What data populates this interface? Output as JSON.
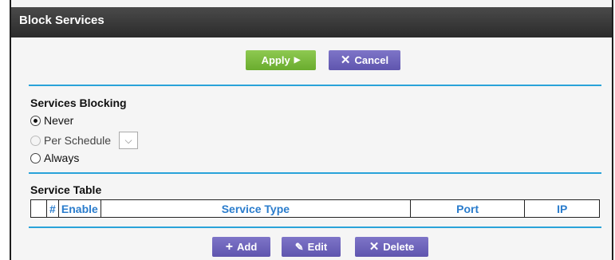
{
  "page": {
    "title": "Block Services"
  },
  "actions": {
    "apply_label": "Apply",
    "apply_icon": "play-icon",
    "cancel_label": "Cancel",
    "cancel_icon": "close-icon"
  },
  "blocking": {
    "title": "Services Blocking",
    "options": [
      {
        "label": "Never",
        "selected": true,
        "enabled": true
      },
      {
        "label": "Per Schedule",
        "selected": false,
        "enabled": false
      },
      {
        "label": "Always",
        "selected": false,
        "enabled": true
      }
    ],
    "schedule_select_value": ""
  },
  "service_table": {
    "title": "Service Table",
    "columns": [
      "",
      "#",
      "Enable",
      "Service Type",
      "Port",
      "IP"
    ],
    "rows": []
  },
  "table_actions": {
    "add_label": "Add",
    "edit_label": "Edit",
    "delete_label": "Delete"
  },
  "colors": {
    "accent_blue": "#29a3d9",
    "apply_green": "#78b83a",
    "button_purple": "#6b62bd",
    "header_text": "#2a7ccc"
  }
}
